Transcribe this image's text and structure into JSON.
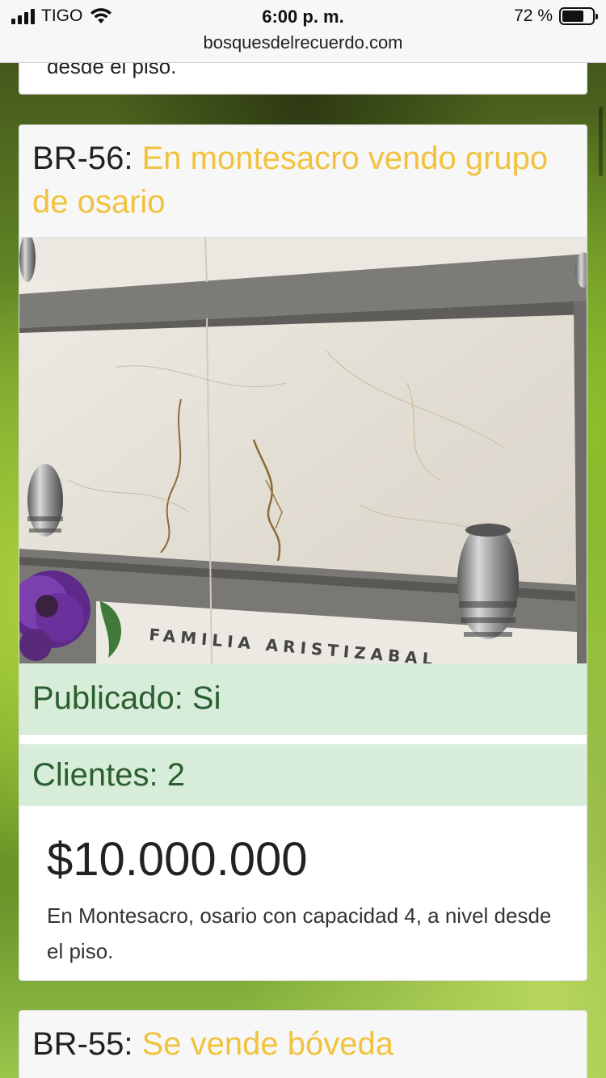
{
  "status_bar": {
    "carrier": "TIGO",
    "time": "6:00 p. m.",
    "battery_pct": "72 %",
    "battery_level": 0.72,
    "url": "bosquesdelrecuerdo.com"
  },
  "previous_listing": {
    "text_tail": "desde el piso."
  },
  "listing": {
    "code": "BR-56:",
    "title": "En montesacro vendo grupo de osario",
    "photo_text": "FAMILIA ARISTIZABAL",
    "published_label": "Publicado: Si",
    "clients_label": "Clientes: 2",
    "price": "$10.000.000",
    "description": "En Montesacro, osario con capacidad 4, a nivel desde el piso."
  },
  "next_listing": {
    "code": "BR-55:",
    "title": "Se vende bóveda"
  },
  "colors": {
    "title_link": "#f1c23d",
    "status_bg": "#d8ecda",
    "status_text": "#2a5f2f"
  },
  "icons": [
    "signal-icon",
    "wifi-icon",
    "battery-icon"
  ]
}
